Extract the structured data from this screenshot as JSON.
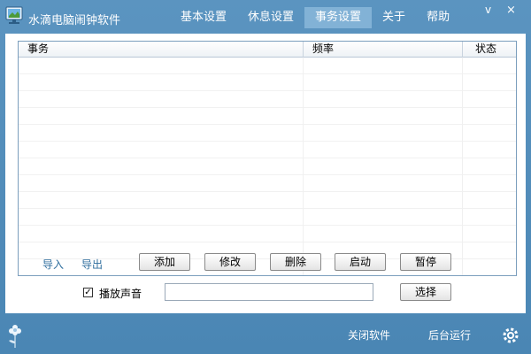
{
  "app": {
    "title": "水滴电脑闹钟软件"
  },
  "nav": {
    "items": [
      {
        "label": "基本设置"
      },
      {
        "label": "休息设置"
      },
      {
        "label": "事务设置",
        "active": true
      },
      {
        "label": "关于"
      },
      {
        "label": "帮助"
      }
    ]
  },
  "window": {
    "minimize": "v",
    "close": "×"
  },
  "table": {
    "columns": [
      "事务",
      "频率",
      "状态"
    ],
    "rows": []
  },
  "actions": {
    "import": "导入",
    "export": "导出",
    "add": "添加",
    "edit": "修改",
    "delete": "删除",
    "start": "启动",
    "pause": "暂停"
  },
  "sound": {
    "checked": true,
    "check_mark": "✓",
    "label": "播放声音",
    "value": "",
    "choose": "选择"
  },
  "footer": {
    "close_software": "关闭软件",
    "run_background": "后台运行"
  },
  "colors": {
    "frame": "#4a86b4",
    "nav_active": "#82b2d6",
    "link": "#2f6e9e"
  },
  "icons": {
    "app": "monitor-icon",
    "flower": "flower-icon",
    "settings": "gear-icon"
  }
}
